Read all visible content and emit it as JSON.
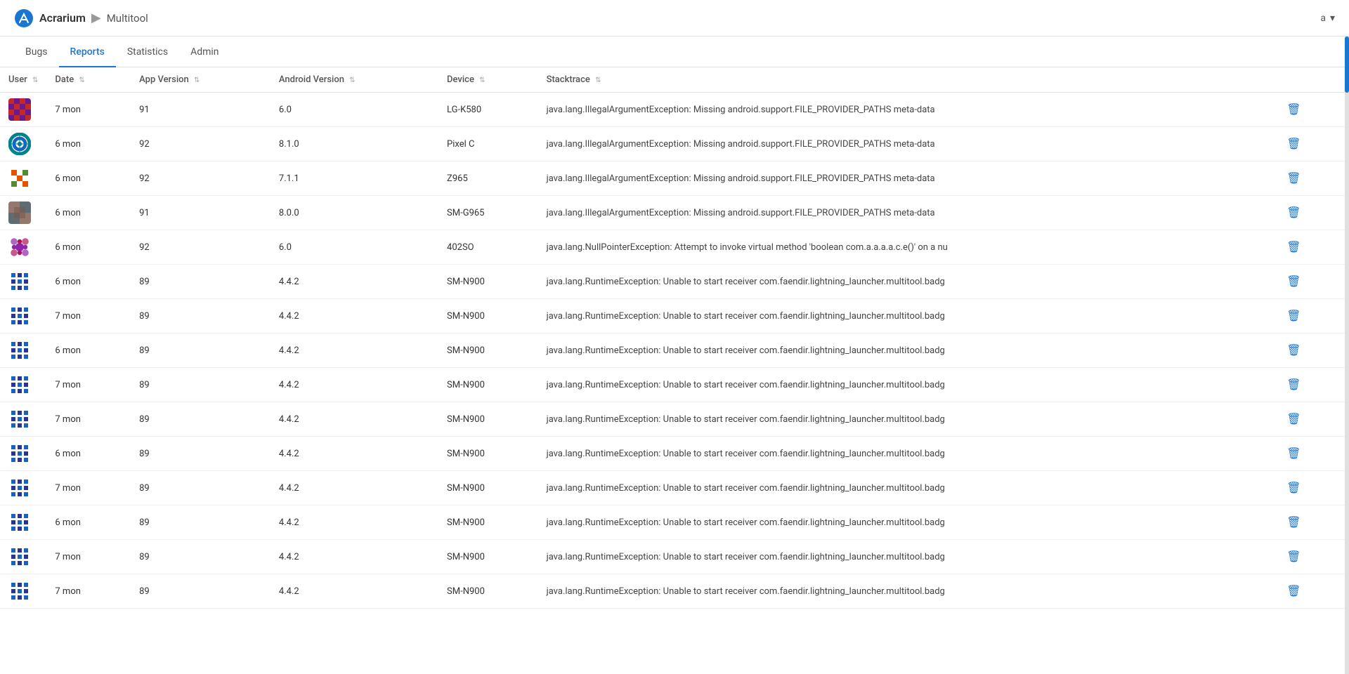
{
  "navbar": {
    "brand_name": "Acrarium",
    "separator": "▶",
    "project_name": "Multitool",
    "user_initial": "a",
    "user_chevron": "▾"
  },
  "tabs": [
    {
      "label": "Bugs",
      "active": false
    },
    {
      "label": "Reports",
      "active": true
    },
    {
      "label": "Statistics",
      "active": false
    },
    {
      "label": "Admin",
      "active": false
    }
  ],
  "table": {
    "columns": [
      {
        "label": "User",
        "key": "user"
      },
      {
        "label": "Date",
        "key": "date"
      },
      {
        "label": "App Version",
        "key": "app_version"
      },
      {
        "label": "Android Version",
        "key": "android_version"
      },
      {
        "label": "Device",
        "key": "device"
      },
      {
        "label": "Stacktrace",
        "key": "stacktrace"
      }
    ],
    "rows": [
      {
        "user_color": "#c62828",
        "user_color2": "#6a1a8a",
        "date": "7 mon",
        "app_version": "91",
        "android_version": "6.0",
        "device": "LG-K580",
        "stacktrace": "java.lang.IllegalArgumentException: Missing android.support.FILE_PROVIDER_PATHS meta-data",
        "avatar_type": "mosaic1"
      },
      {
        "user_color": "#00838f",
        "user_color2": "#1565c0",
        "date": "6 mon",
        "app_version": "92",
        "android_version": "8.1.0",
        "device": "Pixel C",
        "stacktrace": "java.lang.IllegalArgumentException: Missing android.support.FILE_PROVIDER_PATHS meta-data",
        "avatar_type": "mosaic2"
      },
      {
        "user_color": "#e65100",
        "user_color2": "#558b2f",
        "date": "6 mon",
        "app_version": "92",
        "android_version": "7.1.1",
        "device": "Z965",
        "stacktrace": "java.lang.IllegalArgumentException: Missing android.support.FILE_PROVIDER_PATHS meta-data",
        "avatar_type": "mosaic3"
      },
      {
        "user_color": "#795548",
        "user_color2": "#37474f",
        "date": "6 mon",
        "app_version": "91",
        "android_version": "8.0.0",
        "device": "SM-G965",
        "stacktrace": "java.lang.IllegalArgumentException: Missing android.support.FILE_PROVIDER_PATHS meta-data",
        "avatar_type": "mosaic4"
      },
      {
        "user_color": "#8e24aa",
        "user_color2": "#ad1457",
        "date": "6 mon",
        "app_version": "92",
        "android_version": "6.0",
        "device": "402SO",
        "stacktrace": "java.lang.NullPointerException: Attempt to invoke virtual method 'boolean com.a.a.a.a.c.e()' on a nu",
        "avatar_type": "mosaic5"
      },
      {
        "user_color": "#1565c0",
        "user_color2": "#283593",
        "date": "6 mon",
        "app_version": "89",
        "android_version": "4.4.2",
        "device": "SM-N900",
        "stacktrace": "java.lang.RuntimeException: Unable to start receiver com.faendir.lightning_launcher.multitool.badg",
        "avatar_type": "mosaic6"
      },
      {
        "user_color": "#1565c0",
        "user_color2": "#283593",
        "date": "7 mon",
        "app_version": "89",
        "android_version": "4.4.2",
        "device": "SM-N900",
        "stacktrace": "java.lang.RuntimeException: Unable to start receiver com.faendir.lightning_launcher.multitool.badg",
        "avatar_type": "mosaic6"
      },
      {
        "user_color": "#1565c0",
        "user_color2": "#283593",
        "date": "6 mon",
        "app_version": "89",
        "android_version": "4.4.2",
        "device": "SM-N900",
        "stacktrace": "java.lang.RuntimeException: Unable to start receiver com.faendir.lightning_launcher.multitool.badg",
        "avatar_type": "mosaic6"
      },
      {
        "user_color": "#1565c0",
        "user_color2": "#283593",
        "date": "7 mon",
        "app_version": "89",
        "android_version": "4.4.2",
        "device": "SM-N900",
        "stacktrace": "java.lang.RuntimeException: Unable to start receiver com.faendir.lightning_launcher.multitool.badg",
        "avatar_type": "mosaic6"
      },
      {
        "user_color": "#1565c0",
        "user_color2": "#283593",
        "date": "7 mon",
        "app_version": "89",
        "android_version": "4.4.2",
        "device": "SM-N900",
        "stacktrace": "java.lang.RuntimeException: Unable to start receiver com.faendir.lightning_launcher.multitool.badg",
        "avatar_type": "mosaic6"
      },
      {
        "user_color": "#1565c0",
        "user_color2": "#283593",
        "date": "6 mon",
        "app_version": "89",
        "android_version": "4.4.2",
        "device": "SM-N900",
        "stacktrace": "java.lang.RuntimeException: Unable to start receiver com.faendir.lightning_launcher.multitool.badg",
        "avatar_type": "mosaic6"
      },
      {
        "user_color": "#1565c0",
        "user_color2": "#283593",
        "date": "7 mon",
        "app_version": "89",
        "android_version": "4.4.2",
        "device": "SM-N900",
        "stacktrace": "java.lang.RuntimeException: Unable to start receiver com.faendir.lightning_launcher.multitool.badg",
        "avatar_type": "mosaic6"
      },
      {
        "user_color": "#1565c0",
        "user_color2": "#283593",
        "date": "6 mon",
        "app_version": "89",
        "android_version": "4.4.2",
        "device": "SM-N900",
        "stacktrace": "java.lang.RuntimeException: Unable to start receiver com.faendir.lightning_launcher.multitool.badg",
        "avatar_type": "mosaic6"
      },
      {
        "user_color": "#1565c0",
        "user_color2": "#283593",
        "date": "7 mon",
        "app_version": "89",
        "android_version": "4.4.2",
        "device": "SM-N900",
        "stacktrace": "java.lang.RuntimeException: Unable to start receiver com.faendir.lightning_launcher.multitool.badg",
        "avatar_type": "mosaic6"
      },
      {
        "user_color": "#1565c0",
        "user_color2": "#283593",
        "date": "7 mon",
        "app_version": "89",
        "android_version": "4.4.2",
        "device": "SM-N900",
        "stacktrace": "java.lang.RuntimeException: Unable to start receiver com.faendir.lightning_launcher.multitool.badg",
        "avatar_type": "mosaic6"
      }
    ]
  },
  "delete_button_label": "🗑",
  "sort_icon": "⇅",
  "accent_color": "#1976d2"
}
